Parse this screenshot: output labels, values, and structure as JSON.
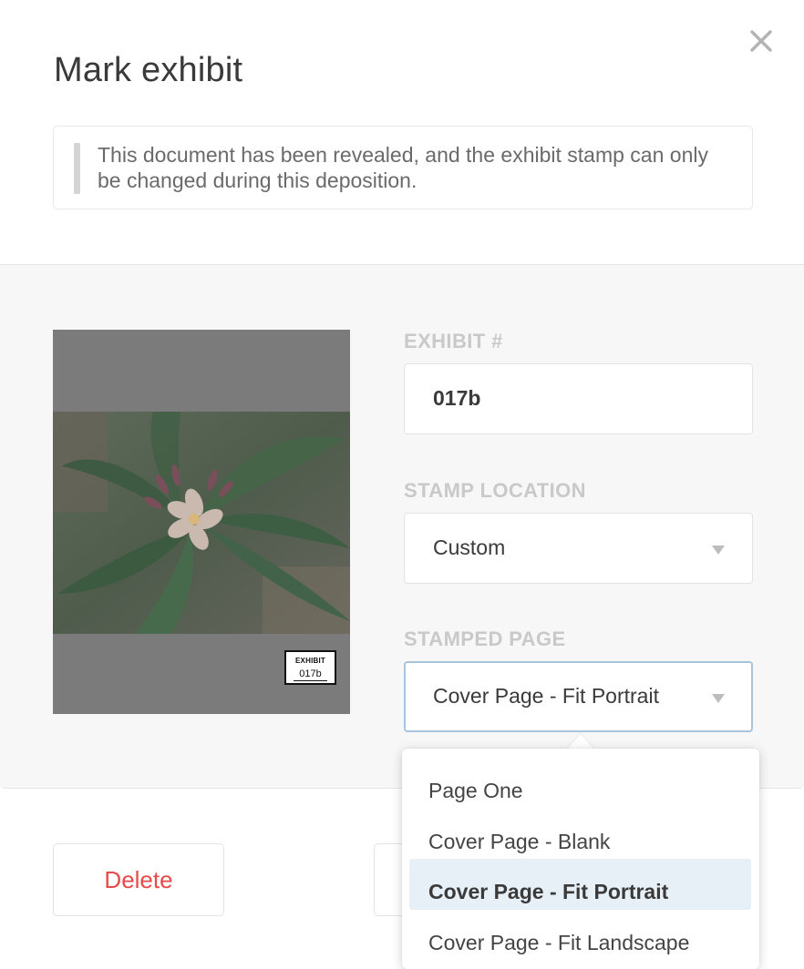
{
  "dialog": {
    "title": "Mark exhibit",
    "notice": "This document has been revealed, and the exhibit stamp can only be changed during this deposition."
  },
  "preview": {
    "stamp_label": "EXHIBIT",
    "stamp_number": "017b"
  },
  "fields": {
    "exhibit_label": "EXHIBIT #",
    "exhibit_value": "017b",
    "location_label": "STAMP LOCATION",
    "location_value": "Custom",
    "page_label": "STAMPED PAGE",
    "page_value": "Cover Page - Fit Portrait"
  },
  "dropdown": {
    "options": [
      "Page One",
      "Cover Page - Blank",
      "Cover Page - Fit Portrait",
      "Cover Page - Fit Landscape"
    ],
    "selected_index": 2
  },
  "footer": {
    "delete_label": "Delete"
  },
  "colors": {
    "delete": "#e84a4a",
    "focus_border": "#a8c4dc",
    "selected_option_bg": "#e7f0f7"
  },
  "icons": {
    "close": "close-icon",
    "caret": "caret-down-icon"
  }
}
